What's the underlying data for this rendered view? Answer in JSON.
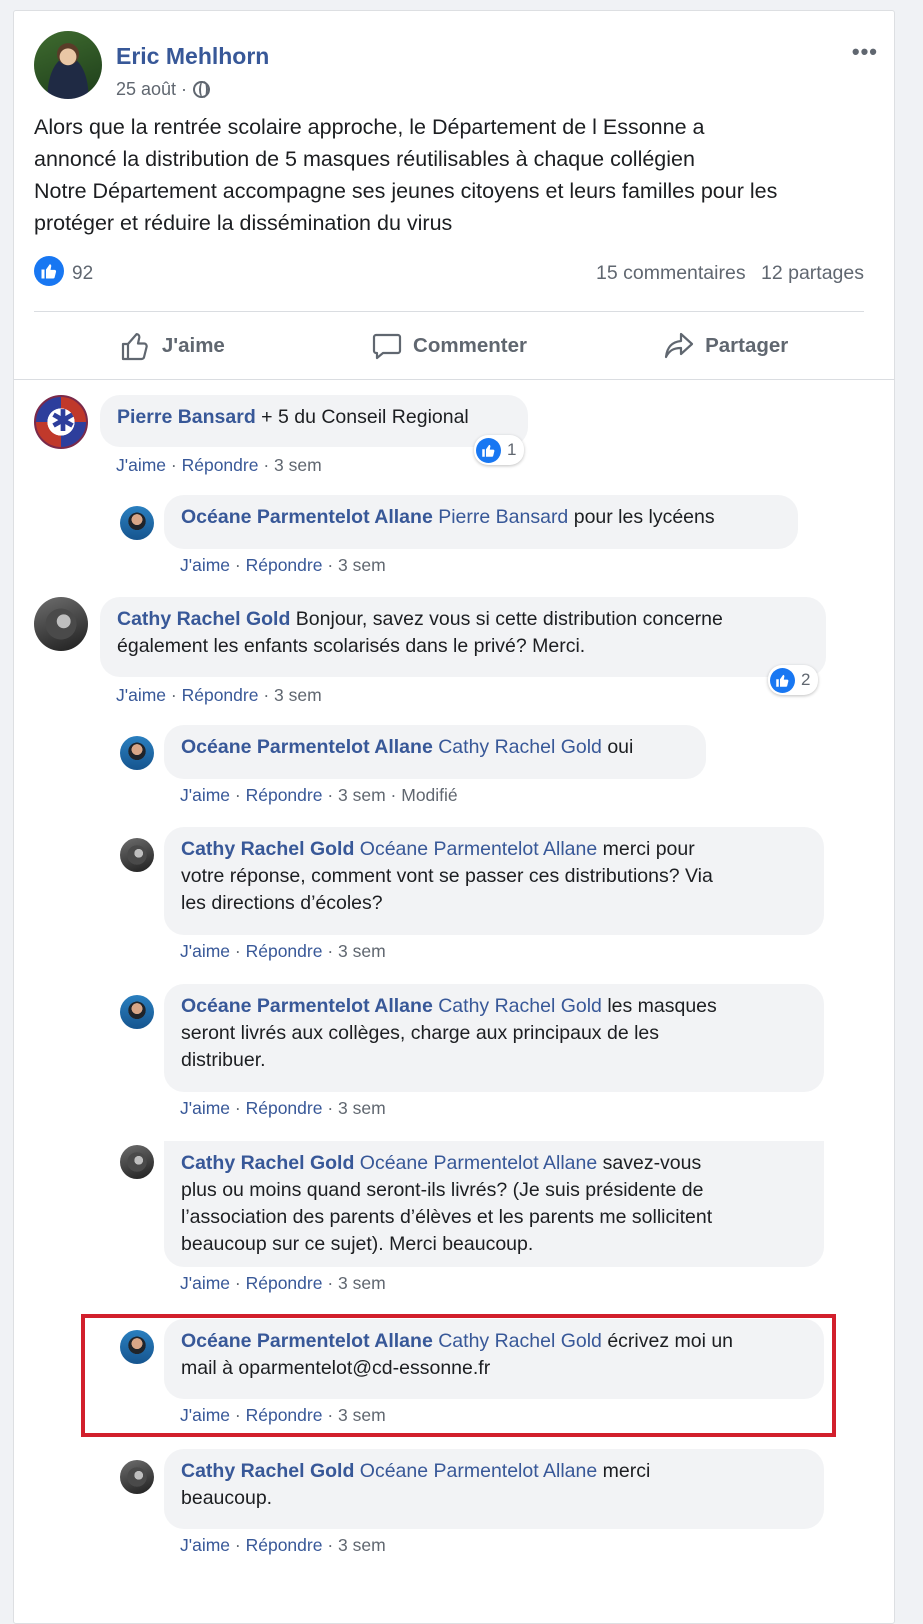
{
  "post": {
    "author": "Eric Mehlhorn",
    "date": "25 août ·",
    "text_lines": [
      "Alors que la rentrée scolaire approche, le Département de l Essonne a",
      "annoncé la distribution de 5 masques réutilisables à chaque collégien",
      "Notre Département accompagne ses jeunes citoyens et leurs familles pour les",
      "protéger et réduire la dissémination du virus"
    ],
    "likes": "92",
    "comments_count": "15 commentaires",
    "shares_count": "12 partages",
    "more": "•••"
  },
  "actions": {
    "like": "J'aime",
    "comment": "Commenter",
    "share": "Partager"
  },
  "comments": [
    {
      "author": "Pierre Bansard",
      "text": "+ 5 du Conseil Regional",
      "reactions": "1",
      "meta": {
        "like": "J'aime",
        "reply": "Répondre",
        "time": "3 sem"
      }
    },
    {
      "author": "Océane Parmentelot Allane",
      "mention": "Pierre Bansard",
      "text": "pour les lycéens",
      "meta": {
        "like": "J'aime",
        "reply": "Répondre",
        "time": "3 sem"
      }
    },
    {
      "author": "Cathy Rachel Gold",
      "text": "Bonjour, savez vous si cette distribution concerne",
      "text2": "également les enfants scolarisés dans le privé? Merci.",
      "reactions": "2",
      "meta": {
        "like": "J'aime",
        "reply": "Répondre",
        "time": "3 sem"
      }
    },
    {
      "author": "Océane Parmentelot Allane",
      "mention": "Cathy Rachel Gold",
      "text": "oui",
      "meta": {
        "like": "J'aime",
        "reply": "Répondre",
        "time": "3 sem",
        "edited": "Modifié"
      }
    },
    {
      "author": "Cathy Rachel Gold",
      "mention": "Océane Parmentelot Allane",
      "text": "merci pour",
      "text2": "votre réponse, comment vont se passer ces distributions? Via",
      "text3": "les directions d’écoles?",
      "meta": {
        "like": "J'aime",
        "reply": "Répondre",
        "time": "3 sem"
      }
    },
    {
      "author": "Océane Parmentelot Allane",
      "mention": "Cathy Rachel Gold",
      "text": "les masques",
      "text2": "seront livrés aux collèges, charge aux principaux de les",
      "text3": "distribuer.",
      "meta": {
        "like": "J'aime",
        "reply": "Répondre",
        "time": "3 sem"
      }
    },
    {
      "author": "Cathy Rachel Gold",
      "mention": "Océane Parmentelot Allane",
      "text": "savez-vous",
      "text2": "plus ou moins quand seront-ils livrés? (Je suis présidente de",
      "text3": "l’association des parents d’élèves et les parents me sollicitent",
      "text4": "beaucoup sur ce sujet). Merci beaucoup.",
      "meta": {
        "like": "J'aime",
        "reply": "Répondre",
        "time": "3 sem"
      }
    },
    {
      "author": "Océane Parmentelot Allane",
      "mention": "Cathy Rachel Gold",
      "text": "écrivez moi un",
      "text2": "mail à oparmentelot@cd-essonne.fr",
      "meta": {
        "like": "J'aime",
        "reply": "Répondre",
        "time": "3 sem"
      }
    },
    {
      "author": "Cathy Rachel Gold",
      "mention": "Océane Parmentelot Allane",
      "text": "merci",
      "text2": "beaucoup.",
      "meta": {
        "like": "J'aime",
        "reply": "Répondre",
        "time": "3 sem"
      }
    }
  ],
  "colors": {
    "link": "#385898",
    "meta_gray": "#606770",
    "bubble": "#f2f3f5",
    "like_blue": "#1877f2",
    "highlight_red": "#d21f2c"
  }
}
